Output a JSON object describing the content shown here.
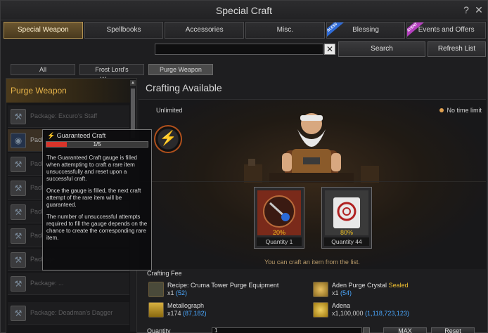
{
  "window": {
    "title": "Special Craft",
    "help_glyph": "?",
    "close_glyph": "✕"
  },
  "tabs": [
    {
      "label": "Special Weapon",
      "active": true
    },
    {
      "label": "Spellbooks"
    },
    {
      "label": "Accessories"
    },
    {
      "label": "Misc."
    },
    {
      "label": "Blessing",
      "ribbon": "BLESS"
    },
    {
      "label": "Events and Offers",
      "ribbon": "EVENT"
    }
  ],
  "search": {
    "value": "",
    "clear_glyph": "✕",
    "button": "Search",
    "refresh": "Refresh List"
  },
  "filters": [
    {
      "label": "All"
    },
    {
      "label": "Frost Lord's Weapon"
    },
    {
      "label": "Purge Weapon",
      "active": true
    }
  ],
  "left_panel": {
    "header": "Purge Weapon",
    "items": [
      {
        "label": "Package: Excuro's Staff"
      },
      {
        "label": "Package: ...",
        "selected": true
      },
      {
        "label": "Package: ..."
      },
      {
        "label": "Package: ..."
      },
      {
        "label": "Package: ..."
      },
      {
        "label": "Package: ..."
      },
      {
        "label": "Package: ..."
      },
      {
        "label": "Package: ..."
      },
      {
        "label": "Package: Deadman's Dagger"
      }
    ],
    "scroll_up": "▲"
  },
  "tooltip": {
    "title": "Guaranteed Craft",
    "gauge_text": "1/5",
    "gauge_fraction": 0.2,
    "paragraphs": [
      "The Guaranteed Craft gauge is filled when attempting to craft a rare item unsuccessfully and reset upon a successful craft.",
      "Once the gauge is filled, the next craft attempt of the rare item will be guaranteed.",
      "The number of unsuccessful attempts required to fill the gauge depends on the chance to create the corresponding rare item."
    ]
  },
  "crafting": {
    "title": "Crafting Available",
    "unlimited": "Unlimited",
    "no_time_limit": "No time limit",
    "results": [
      {
        "chance": "20%",
        "quantity": "Quantity 1"
      },
      {
        "chance": "80%",
        "quantity": "Quantity 44"
      }
    ],
    "hint": "You can craft an item from the list."
  },
  "fee": {
    "title": "Crafting Fee",
    "items": [
      {
        "name": "Recipe: Cruma Tower Purge Equipment",
        "req": "x1",
        "have": "(52)"
      },
      {
        "name": "Aden Purge Crystal",
        "sealed": "Sealed",
        "req": "x1",
        "have": "(54)"
      },
      {
        "name": "Metallograph",
        "req": "x174",
        "have": "(87,182)"
      },
      {
        "name": "Adena",
        "req": "x1,100,000",
        "have": "(1,118,723,123)"
      }
    ]
  },
  "quantity": {
    "label": "Quantity",
    "value": "1",
    "max": "MAX",
    "reset": "Reset"
  },
  "colors": {
    "accent": "#e8b54a",
    "have": "#4aa8ff",
    "sealed": "#f0c030",
    "gauge": "#d9342a"
  }
}
